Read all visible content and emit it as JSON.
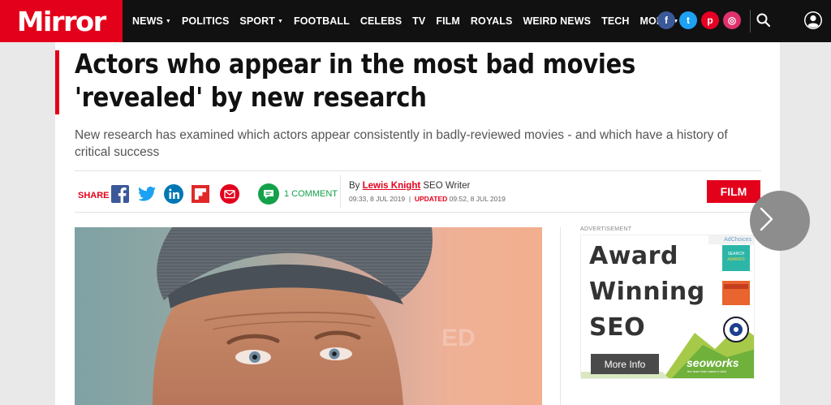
{
  "header": {
    "logo": "Mirror",
    "nav": [
      {
        "label": "NEWS",
        "dropdown": true
      },
      {
        "label": "POLITICS",
        "dropdown": false
      },
      {
        "label": "SPORT",
        "dropdown": true
      },
      {
        "label": "FOOTBALL",
        "dropdown": false
      },
      {
        "label": "CELEBS",
        "dropdown": false
      },
      {
        "label": "TV",
        "dropdown": false
      },
      {
        "label": "FILM",
        "dropdown": false
      },
      {
        "label": "ROYALS",
        "dropdown": false
      },
      {
        "label": "WEIRD NEWS",
        "dropdown": false
      },
      {
        "label": "TECH",
        "dropdown": false
      },
      {
        "label": "MORE",
        "dropdown": true
      }
    ],
    "social": [
      {
        "icon": "facebook-icon",
        "glyph": "f",
        "color": "#3b5998"
      },
      {
        "icon": "twitter-icon",
        "glyph": "t",
        "color": "#1da1f2"
      },
      {
        "icon": "pinterest-icon",
        "glyph": "p",
        "color": "#e60023"
      },
      {
        "icon": "instagram-icon",
        "glyph": "◎",
        "color": "#e1306c"
      }
    ]
  },
  "article": {
    "headline": "Actors who appear in the most bad movies 'revealed' by new research",
    "standfirst": "New research has examined which actors appear consistently in badly-reviewed movies - and which have a history of critical success",
    "share_label": "SHARE",
    "comments": "1 COMMENT",
    "byline_prefix": "By",
    "author": "Lewis Knight",
    "author_role": "SEO Writer",
    "published": "09:33, 8 JUL 2019",
    "updated_label": "UPDATED",
    "updated": "09:52, 8 JUL 2019",
    "tag": "FILM",
    "hero_caption_fragment": "ED"
  },
  "advert": {
    "label": "ADVERTISEMENT",
    "adchoices": "AdChoices",
    "lines": [
      "Award",
      "Winning",
      "SEO"
    ],
    "button": "More Info",
    "brand": "seoworks",
    "tagline": "the team that makes it click"
  },
  "colors": {
    "brand_red": "#e3001b",
    "comment_green": "#13a14a"
  }
}
